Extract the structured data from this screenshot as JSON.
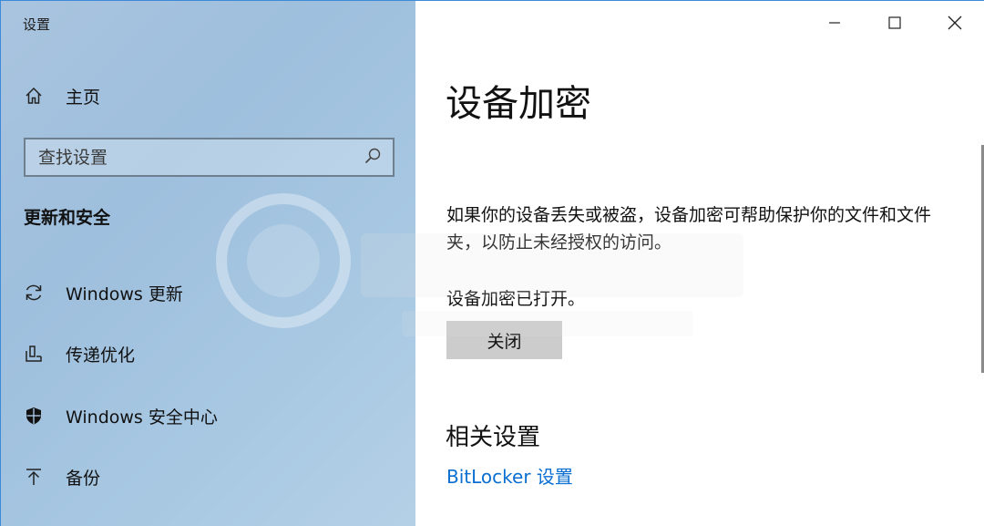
{
  "window": {
    "title": "设置",
    "controls": [
      "minimize",
      "maximize",
      "close"
    ]
  },
  "sidebar": {
    "home_label": "主页",
    "search": {
      "placeholder": "查找设置"
    },
    "section_heading": "更新和安全",
    "items": [
      {
        "label": "Windows 更新",
        "icon": "refresh-icon"
      },
      {
        "label": "传递优化",
        "icon": "delivery-optimization-icon"
      },
      {
        "label": "Windows 安全中心",
        "icon": "shield-icon"
      },
      {
        "label": "备份",
        "icon": "backup-arrow-icon"
      }
    ]
  },
  "main": {
    "title": "设备加密",
    "description": "如果你的设备丢失或被盗，设备加密可帮助保护你的文件和文件夹，以防止未经授权的访问。",
    "status": "设备加密已打开。",
    "off_button": "关闭",
    "related_heading": "相关设置",
    "bitlocker_link": "BitLocker 设置"
  },
  "colors": {
    "accent": "#0a6fd1",
    "sidebar_bg": "#a8c6e0",
    "button_bg": "#cccccc"
  }
}
